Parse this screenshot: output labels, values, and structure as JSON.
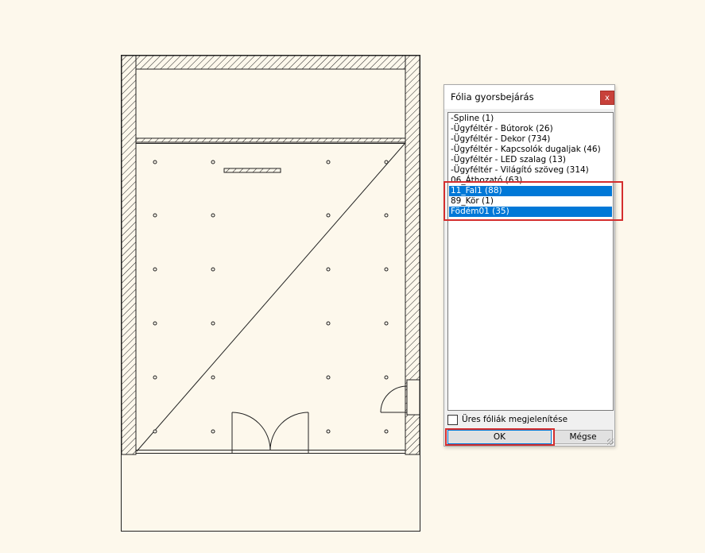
{
  "dialog": {
    "title": "Fólia gyorsbejárás",
    "close_label": "x",
    "items": [
      {
        "label": "-Spline (1)",
        "selected": false
      },
      {
        "label": "-Ügyféltér - Bútorok (26)",
        "selected": false
      },
      {
        "label": "-Ügyféltér - Dekor (734)",
        "selected": false
      },
      {
        "label": "-Ügyféltér - Kapcsolók dugaljak (46)",
        "selected": false
      },
      {
        "label": "-Ügyféltér - LED szalag (13)",
        "selected": false
      },
      {
        "label": "-Ügyféltér - Világító szöveg (314)",
        "selected": false
      },
      {
        "label": "06_Áthozató (63)",
        "selected": false
      },
      {
        "label": "11_Fal1 (88)",
        "selected": true
      },
      {
        "label": "89_Kör (1)",
        "selected": false
      },
      {
        "label": "Födém01 (35)",
        "selected": true
      }
    ],
    "show_empty_label": "Üres fóliák megjelenítése",
    "show_empty_checked": false,
    "ok_label": "OK",
    "cancel_label": "Mégse"
  },
  "colors": {
    "background": "#fdf8ec",
    "selection": "#0078d7",
    "highlight": "#d42e2e"
  }
}
